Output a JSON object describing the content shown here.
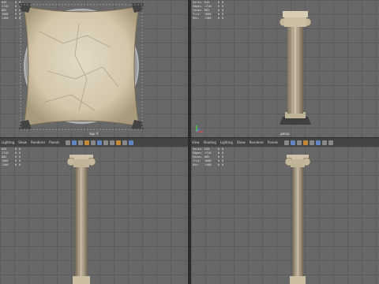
{
  "viewports": {
    "top": {
      "label": "top -Y",
      "hud": [
        {
          "label": "Verts:",
          "a": "645",
          "b": "0",
          "c": "0"
        },
        {
          "label": "Edges:",
          "a": "1710",
          "b": "0",
          "c": "0"
        },
        {
          "label": "Faces:",
          "a": "882",
          "b": "0",
          "c": "0"
        },
        {
          "label": "Tris:",
          "a": "1600",
          "b": "0",
          "c": "0"
        },
        {
          "label": "UVs:",
          "a": "1160",
          "b": "0",
          "c": "0"
        }
      ]
    },
    "persp": {
      "label": "persp",
      "hud": [
        {
          "label": "Verts:",
          "a": "645",
          "b": "0",
          "c": "0"
        },
        {
          "label": "Edges:",
          "a": "1710",
          "b": "0",
          "c": "0"
        },
        {
          "label": "Faces:",
          "a": "882",
          "b": "0",
          "c": "0"
        },
        {
          "label": "Tris:",
          "a": "1600",
          "b": "0",
          "c": "0"
        },
        {
          "label": "UVs:",
          "a": "1160",
          "b": "0",
          "c": "0"
        }
      ]
    },
    "front": {
      "menu": [
        "Lighting",
        "Show",
        "Renderer",
        "Panels"
      ],
      "hud": [
        {
          "label": "Verts:",
          "a": "645",
          "b": "0",
          "c": "0"
        },
        {
          "label": "Edges:",
          "a": "1710",
          "b": "0",
          "c": "0"
        },
        {
          "label": "Faces:",
          "a": "882",
          "b": "0",
          "c": "0"
        },
        {
          "label": "Tris:",
          "a": "1600",
          "b": "0",
          "c": "0"
        },
        {
          "label": "UVs:",
          "a": "1160",
          "b": "0",
          "c": "0"
        }
      ]
    },
    "side": {
      "menu": [
        "View",
        "Shading",
        "Lighting",
        "Show",
        "Renderer",
        "Panels"
      ],
      "hud": [
        {
          "label": "Verts:",
          "a": "645",
          "b": "0",
          "c": "0"
        },
        {
          "label": "Edges:",
          "a": "1710",
          "b": "0",
          "c": "0"
        },
        {
          "label": "Faces:",
          "a": "882",
          "b": "0",
          "c": "0"
        },
        {
          "label": "Tris:",
          "a": "1600",
          "b": "0",
          "c": "0"
        },
        {
          "label": "UVs:",
          "a": "1160",
          "b": "0",
          "c": "0"
        }
      ]
    }
  },
  "colors": {
    "grid_bg": "#686868",
    "marble": "#d8cdb6",
    "marble_dark": "#8c7f67"
  },
  "icons": [
    "viewport-select-icon",
    "wireframe-icon",
    "smooth-shade-icon",
    "texture-icon",
    "light-icon",
    "camera-icon"
  ]
}
